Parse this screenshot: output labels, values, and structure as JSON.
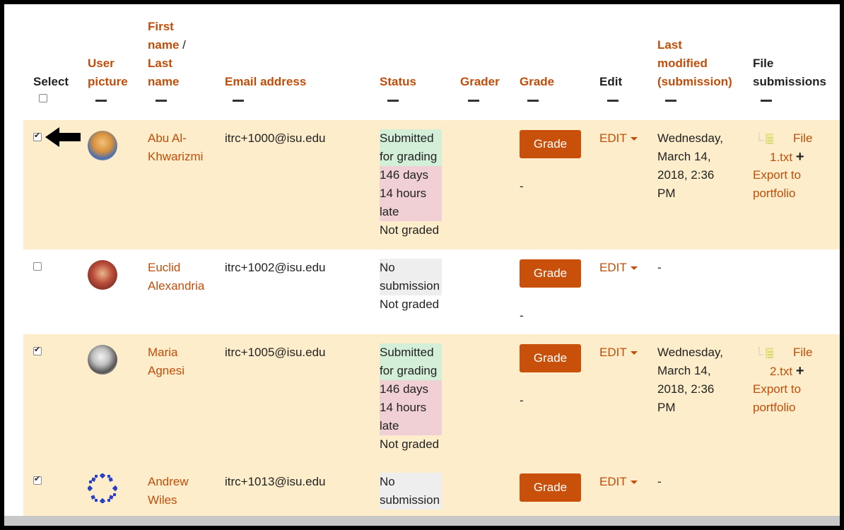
{
  "headers": {
    "select": "Select",
    "user_picture": [
      "User",
      "picture"
    ],
    "first_name": [
      "First",
      "name"
    ],
    "name_sep": " /",
    "last_name": [
      "Last",
      "name"
    ],
    "email": "Email address",
    "status": "Status",
    "grader": "Grader",
    "grade": "Grade",
    "edit": "Edit",
    "last_modified": [
      "Last",
      "modified",
      "(submission)"
    ],
    "file_submissions": [
      "File",
      "submissions"
    ]
  },
  "rows": [
    {
      "selected": true,
      "name": [
        "Abu Al-",
        "Khwarizmi"
      ],
      "email": "itrc+1000@isu.edu",
      "status_submitted": [
        "Submitted",
        "for grading"
      ],
      "status_late": [
        "146 days",
        "14 hours",
        "late"
      ],
      "status_graded": "Not graded",
      "grade_button": "Grade",
      "grade_value": "-",
      "edit": "EDIT",
      "last_modified": [
        "Wednesday,",
        "March 14,",
        "2018, 2:36",
        "PM"
      ],
      "file_name": [
        "File",
        "1.txt"
      ],
      "export": [
        "Export to",
        "portfolio"
      ]
    },
    {
      "selected": false,
      "name": [
        "Euclid",
        "Alexandria"
      ],
      "email": "itrc+1002@isu.edu",
      "status_nosub": [
        "No",
        "submission"
      ],
      "status_graded": "Not graded",
      "grade_button": "Grade",
      "grade_value": "-",
      "edit": "EDIT",
      "last_modified": "-"
    },
    {
      "selected": true,
      "name": [
        "Maria",
        "Agnesi"
      ],
      "email": "itrc+1005@isu.edu",
      "status_submitted": [
        "Submitted",
        "for grading"
      ],
      "status_late": [
        "146 days",
        "14 hours",
        "late"
      ],
      "status_graded": "Not graded",
      "grade_button": "Grade",
      "grade_value": "-",
      "edit": "EDIT",
      "last_modified": [
        "Wednesday,",
        "March 14,",
        "2018, 2:36",
        "PM"
      ],
      "file_name": [
        "File",
        "2.txt"
      ],
      "export": [
        "Export to",
        "portfolio"
      ]
    },
    {
      "selected": true,
      "name": [
        "Andrew",
        "Wiles"
      ],
      "email": "itrc+1013@isu.edu",
      "status_nosub": [
        "No",
        "submission"
      ],
      "grade_button": "Grade",
      "edit": "EDIT",
      "last_modified": "-"
    }
  ],
  "icons": {
    "arrow": "arrow-left-icon",
    "file": "file-icon",
    "plus": "plus-icon",
    "caret": "caret-down-icon"
  },
  "colors": {
    "link": "#c04e0a",
    "row_highlight": "#fdedca",
    "status_submitted": "#d4efd7",
    "status_late": "#f0d0d5",
    "button": "#c9500a"
  }
}
